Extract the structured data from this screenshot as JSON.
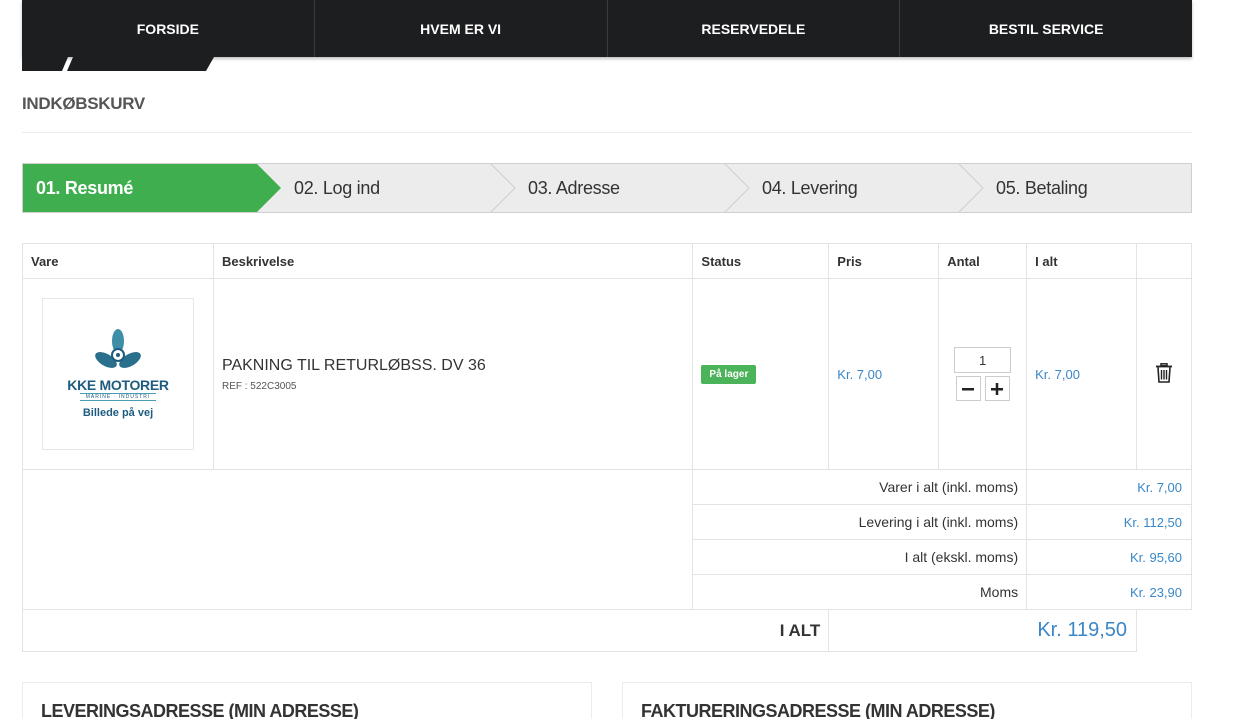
{
  "nav": {
    "items": [
      "FORSIDE",
      "HVEM ER VI",
      "RESERVEDELE",
      "BESTIL SERVICE"
    ]
  },
  "page": {
    "title": "INDKØBSKURV"
  },
  "steps": [
    {
      "label": "01. Resumé",
      "active": true
    },
    {
      "label": "02. Log ind",
      "active": false
    },
    {
      "label": "03. Adresse",
      "active": false
    },
    {
      "label": "04. Levering",
      "active": false
    },
    {
      "label": "05. Betaling",
      "active": false
    }
  ],
  "colors": {
    "step_active": "#3fae4f",
    "price_blue": "#3a87c8",
    "nav_bg": "#1d1e20"
  },
  "cart": {
    "headers": {
      "item": "Vare",
      "description": "Beskrivelse",
      "status": "Status",
      "price": "Pris",
      "qty": "Antal",
      "total": "I alt"
    },
    "product": {
      "logo_text": "KKE MOTORER",
      "logo_sub": "MARINE · INDUSTRI",
      "image_caption": "Billede på vej",
      "name": "PAKNING TIL RETURLØBSS. DV 36",
      "ref": "REF : 522C3005",
      "status": "På lager",
      "price": "Kr. 7,00",
      "qty": "1",
      "line_total": "Kr. 7,00",
      "remove_icon": "trash-icon"
    },
    "summary": [
      {
        "label": "Varer i alt (inkl. moms)",
        "value": "Kr. 7,00"
      },
      {
        "label": "Levering i alt (inkl. moms)",
        "value": "Kr. 112,50"
      },
      {
        "label": "I alt (ekskl. moms)",
        "value": "Kr. 95,60"
      },
      {
        "label": "Moms",
        "value": "Kr. 23,90"
      }
    ],
    "grand_total": {
      "label": "I ALT",
      "value": "Kr. 119,50"
    }
  },
  "addresses": {
    "delivery_title": "LEVERINGSADRESSE (MIN ADRESSE)",
    "billing_title": "FAKTURERINGSADRESSE (MIN ADRESSE)"
  }
}
